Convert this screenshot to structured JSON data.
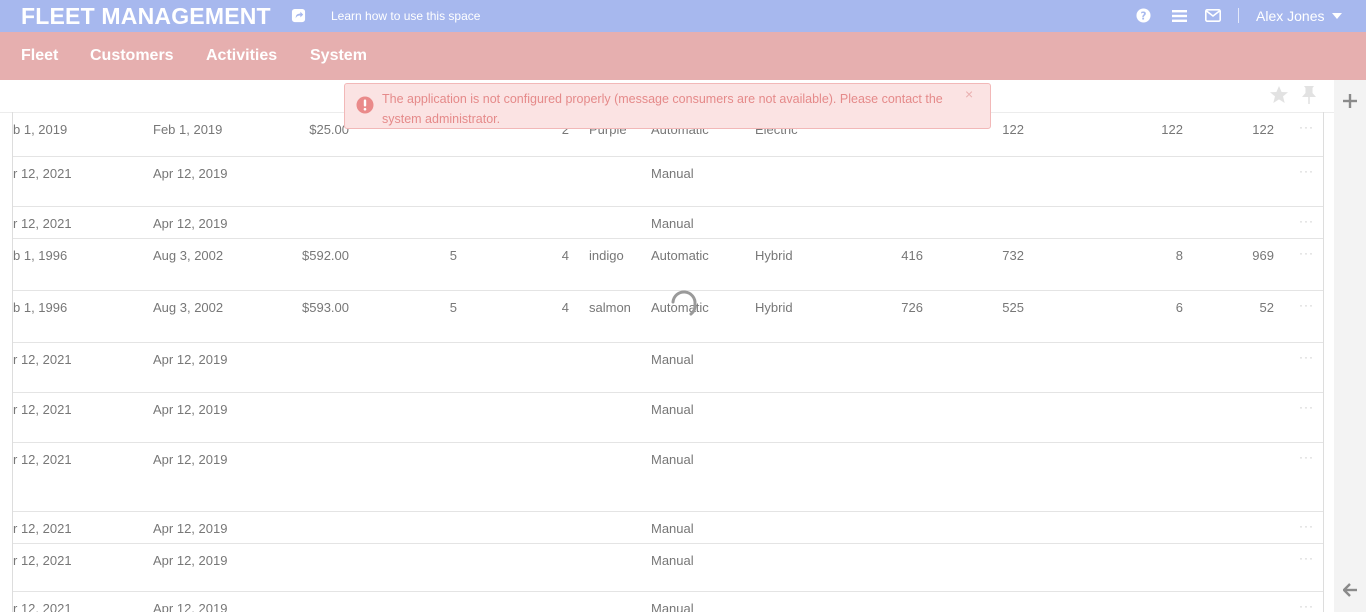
{
  "header": {
    "brand": "FLEET MANAGEMENT",
    "learn_link": "Learn how to use this space",
    "user_name": "Alex Jones"
  },
  "nav": {
    "items": [
      {
        "label": "Fleet"
      },
      {
        "label": "Customers"
      },
      {
        "label": "Activities"
      },
      {
        "label": "System"
      }
    ]
  },
  "alert": {
    "message": "The application is not configured properly (message consumers are not available). Please contact the system administrator.",
    "close": "×"
  },
  "grid": {
    "rows": [
      {
        "c1": "b 1, 2019",
        "c2": "Feb 1, 2019",
        "c3": "$25.00",
        "c4": "",
        "c5": "2",
        "c6": "Purple",
        "c7": "Automatic",
        "c8": "Electric",
        "c9": "",
        "c10": "122",
        "c11": "122",
        "c12": "122",
        "more": "···"
      },
      {
        "c1": "r 12, 2021",
        "c2": "Apr 12, 2019",
        "c3": "",
        "c4": "",
        "c5": "",
        "c6": "",
        "c7": "Manual",
        "c8": "",
        "c9": "",
        "c10": "",
        "c11": "",
        "c12": "",
        "more": "···"
      },
      {
        "c1": "r 12, 2021",
        "c2": "Apr 12, 2019",
        "c3": "",
        "c4": "",
        "c5": "",
        "c6": "",
        "c7": "Manual",
        "c8": "",
        "c9": "",
        "c10": "",
        "c11": "",
        "c12": "",
        "more": "···"
      },
      {
        "c1": "b 1, 1996",
        "c2": "Aug 3, 2002",
        "c3": "$592.00",
        "c4": "5",
        "c5": "4",
        "c6": "indigo",
        "c7": "Automatic",
        "c8": "Hybrid",
        "c9": "416",
        "c10": "732",
        "c11": "8",
        "c12": "969",
        "more": "···"
      },
      {
        "c1": "b 1, 1996",
        "c2": "Aug 3, 2002",
        "c3": "$593.00",
        "c4": "5",
        "c5": "4",
        "c6": "salmon",
        "c7": "Automatic",
        "c8": "Hybrid",
        "c9": "726",
        "c10": "525",
        "c11": "6",
        "c12": "52",
        "more": "···"
      },
      {
        "c1": "r 12, 2021",
        "c2": "Apr 12, 2019",
        "c3": "",
        "c4": "",
        "c5": "",
        "c6": "",
        "c7": "Manual",
        "c8": "",
        "c9": "",
        "c10": "",
        "c11": "",
        "c12": "",
        "more": "···"
      },
      {
        "c1": "r 12, 2021",
        "c2": "Apr 12, 2019",
        "c3": "",
        "c4": "",
        "c5": "",
        "c6": "",
        "c7": "Manual",
        "c8": "",
        "c9": "",
        "c10": "",
        "c11": "",
        "c12": "",
        "more": "···"
      },
      {
        "c1": "r 12, 2021",
        "c2": "Apr 12, 2019",
        "c3": "",
        "c4": "",
        "c5": "",
        "c6": "",
        "c7": "Manual",
        "c8": "",
        "c9": "",
        "c10": "",
        "c11": "",
        "c12": "",
        "more": "···"
      },
      {
        "c1": "r 12, 2021",
        "c2": "Apr 12, 2019",
        "c3": "",
        "c4": "",
        "c5": "",
        "c6": "",
        "c7": "Manual",
        "c8": "",
        "c9": "",
        "c10": "",
        "c11": "",
        "c12": "",
        "more": "···"
      },
      {
        "c1": "r 12, 2021",
        "c2": "Apr 12, 2019",
        "c3": "",
        "c4": "",
        "c5": "",
        "c6": "",
        "c7": "Manual",
        "c8": "",
        "c9": "",
        "c10": "",
        "c11": "",
        "c12": "",
        "more": "···"
      },
      {
        "c1": "r 12, 2021",
        "c2": "Apr 12, 2019",
        "c3": "",
        "c4": "",
        "c5": "",
        "c6": "",
        "c7": "Manual",
        "c8": "",
        "c9": "",
        "c10": "",
        "c11": "",
        "c12": "",
        "more": "···"
      }
    ]
  },
  "icons": {
    "share": "share-icon",
    "help": "help-icon",
    "menu": "menu-icon",
    "mail": "mail-icon",
    "caret": "caret-down-icon",
    "star": "star-icon",
    "pin": "pin-icon",
    "plus": "plus-icon",
    "back": "arrow-left-icon",
    "alert": "exclamation-circle-icon",
    "spinner": "loading-spinner"
  },
  "colors": {
    "topbar": "#a7b8ee",
    "navbar": "#e6afaf",
    "alert_bg": "#fbe3e3",
    "alert_text": "#e58a8a"
  }
}
